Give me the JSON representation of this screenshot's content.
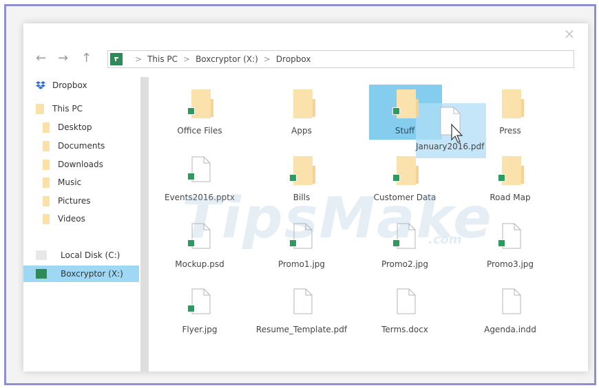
{
  "window": {
    "close_icon": "×"
  },
  "nav": {
    "back": "←",
    "forward": "→",
    "up": "↑"
  },
  "breadcrumb": [
    "This PC",
    "Boxcryptor (X:)",
    "Dropbox"
  ],
  "breadcrumb_sep": ">",
  "sidebar": {
    "dropbox": "Dropbox",
    "this_pc": "This PC",
    "folders": [
      "Desktop",
      "Documents",
      "Downloads",
      "Music",
      "Pictures",
      "Videos"
    ],
    "local_disk": "Local Disk (C:)",
    "boxcryptor": "Boxcryptor (X:)"
  },
  "items": [
    {
      "label": "Office Files",
      "type": "folder",
      "badge": true
    },
    {
      "label": "Apps",
      "type": "folder",
      "badge": false
    },
    {
      "label": "Stuff",
      "type": "folder",
      "badge": true,
      "selected": true
    },
    {
      "label": "Press",
      "type": "folder",
      "badge": false
    },
    {
      "label": "Events2016.pptx",
      "type": "file",
      "badge": true
    },
    {
      "label": "Bills",
      "type": "folder",
      "badge": true
    },
    {
      "label": "Customer Data",
      "type": "folder",
      "badge": true
    },
    {
      "label": "Road Map",
      "type": "folder",
      "badge": true
    },
    {
      "label": "Mockup.psd",
      "type": "file",
      "badge": true
    },
    {
      "label": "Promo1.jpg",
      "type": "file",
      "badge": true
    },
    {
      "label": "Promo2.jpg",
      "type": "file",
      "badge": true
    },
    {
      "label": "Promo3.jpg",
      "type": "file",
      "badge": true
    },
    {
      "label": "Flyer.jpg",
      "type": "file",
      "badge": true
    },
    {
      "label": "Resume_Template.pdf",
      "type": "file",
      "badge": false
    },
    {
      "label": "Terms.docx",
      "type": "file",
      "badge": false
    },
    {
      "label": "Agenda.indd",
      "type": "file",
      "badge": false
    }
  ],
  "drag": {
    "label": "January2016.pdf"
  },
  "watermark": {
    "main": "TipsMake",
    "sub": ".com"
  },
  "colors": {
    "accent_green": "#2a9d5e",
    "folder": "#fbe2ad",
    "selection": "#84cdee",
    "frame": "#8c8fd6"
  }
}
